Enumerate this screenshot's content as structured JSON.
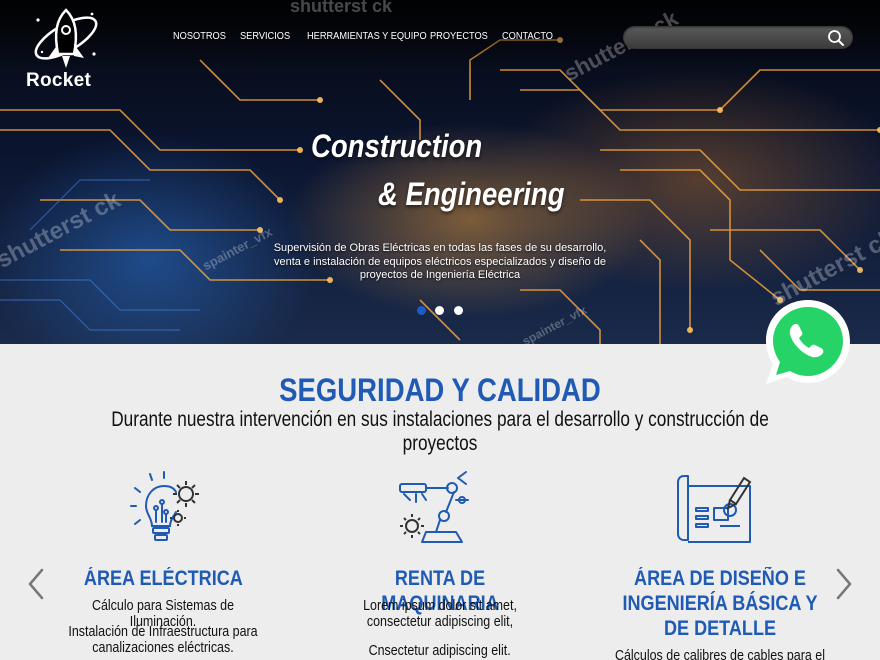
{
  "brand": {
    "name": "Rocket"
  },
  "nav": {
    "items": [
      {
        "label": "NOSOTROS"
      },
      {
        "label": "SERVICIOS"
      },
      {
        "label": "HERRAMIENTAS Y EQUIPO"
      },
      {
        "label": "PROYECTOS"
      },
      {
        "label": "CONTACTO"
      }
    ]
  },
  "search": {
    "placeholder": "",
    "value": ""
  },
  "hero": {
    "title_line1": "Construction",
    "title_line2": "&  Engineering",
    "description": "Supervisión de Obras Eléctricas en todas las fases de su desarrollo, venta e instalación de equipos eléctricos especializados y diseño de proyectos de Ingeniería Eléctrica",
    "slides": 3,
    "active_slide": 1,
    "watermarks": [
      "shutterst ck",
      "shutterst ck",
      "shutterst ck",
      "spainter_vfx",
      "spainter_vfx",
      "shutterst ck"
    ]
  },
  "section": {
    "title": "SEGURIDAD Y CALIDAD",
    "subtitle": "Durante nuestra intervención en sus instalaciones para el desarrollo y construcción de proyectos"
  },
  "cards": [
    {
      "icon": "lightbulb-gear-icon",
      "title": "ÁREA ELÉCTRICA",
      "texts": [
        "Cálculo para Sistemas de Iluminación.",
        "Instalación de Infraestructura para canalizaciones eléctricas."
      ]
    },
    {
      "icon": "robotic-arm-icon",
      "title": "RENTA DE MAQUINARIA",
      "texts": [
        "Lorem ipsum dolor sit amet, consectetur adipiscing elit,",
        "Cnsectetur adipiscing elit."
      ]
    },
    {
      "icon": "blueprint-icon",
      "title": "ÁREA DE DISEÑO E INGENIERÍA BÁSICA Y DE DETALLE",
      "texts": [
        "Cálculos de calibres de cables para el fin"
      ]
    }
  ],
  "colors": {
    "accent": "#1f5bb5",
    "whatsapp": "#25d366",
    "section_bg": "#ededed"
  }
}
